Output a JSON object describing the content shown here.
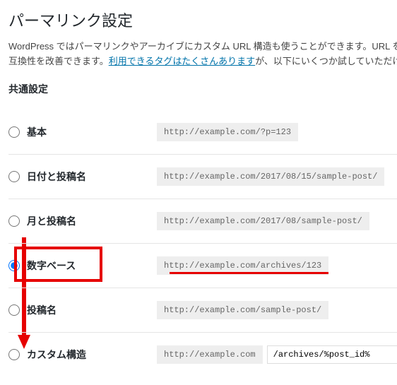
{
  "page": {
    "title": "パーマリンク設定",
    "description_pre": "WordPress ではパーマリンクやアーカイブにカスタム URL 構造も使うことができます。URL をカスタマイ",
    "description_line2_pre": "互換性を改善できます。",
    "link_text": "利用できるタグはたくさんあります",
    "description_line2_post": "が、以下にいくつか試していただける例を用意",
    "section_heading": "共通設定"
  },
  "options": [
    {
      "label": "基本",
      "example": "http://example.com/?p=123",
      "checked": false
    },
    {
      "label": "日付と投稿名",
      "example": "http://example.com/2017/08/15/sample-post/",
      "checked": false
    },
    {
      "label": "月と投稿名",
      "example": "http://example.com/2017/08/sample-post/",
      "checked": false
    },
    {
      "label": "数字ベース",
      "example": "http://example.com/archives/123",
      "checked": true
    },
    {
      "label": "投稿名",
      "example": "http://example.com/sample-post/",
      "checked": false
    },
    {
      "label": "カスタム構造",
      "example": "http://example.com",
      "checked": false
    }
  ],
  "custom": {
    "value": "/archives/%post_id%"
  }
}
